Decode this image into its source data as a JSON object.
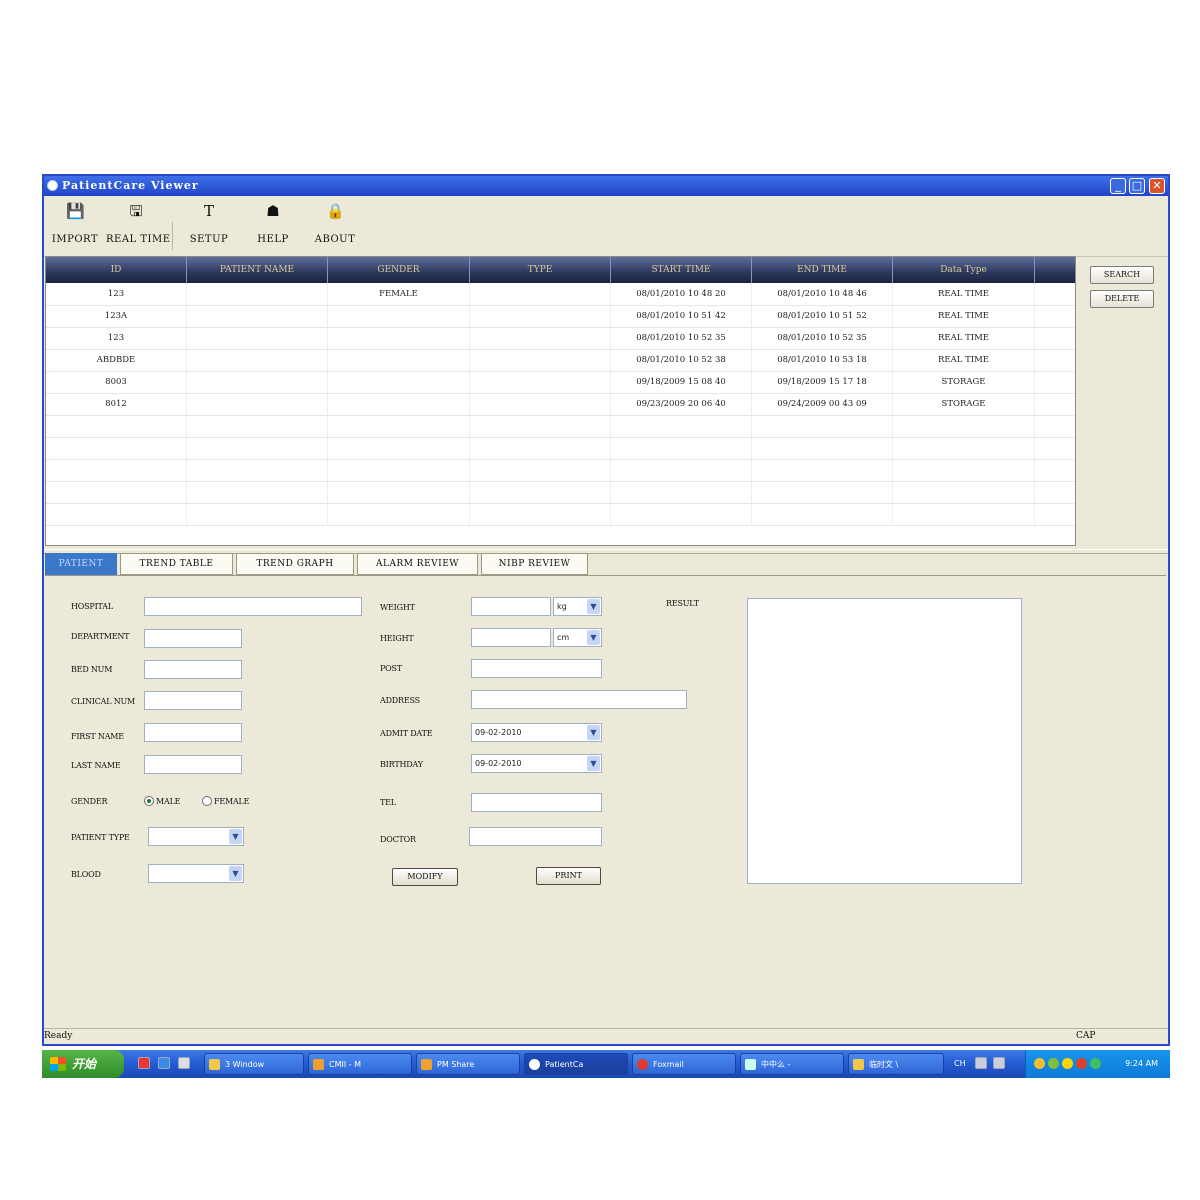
{
  "window": {
    "title": "PatientCare Viewer",
    "min": "_",
    "max": "□",
    "close": "✕"
  },
  "toolbar": [
    {
      "id": "import",
      "label": "IMPORT",
      "icon": "💾"
    },
    {
      "id": "realtime",
      "label": "REAL TIME",
      "icon": "🖫"
    },
    {
      "id": "setup",
      "label": "SETUP",
      "icon": "T"
    },
    {
      "id": "help",
      "label": "HELP",
      "icon": "☗"
    },
    {
      "id": "about",
      "label": "ABOUT",
      "icon": "🔒"
    }
  ],
  "table": {
    "columns": [
      "ID",
      "PATIENT NAME",
      "GENDER",
      "TYPE",
      "START TIME",
      "END   TIME",
      "Data Type"
    ],
    "rows": [
      [
        "123",
        "",
        "FEMALE",
        "",
        "08/01/2010 10 48 20",
        "08/01/2010 10 48 46",
        "REAL TIME"
      ],
      [
        "123A",
        "",
        "",
        "",
        "08/01/2010 10 51 42",
        "08/01/2010 10 51 52",
        "REAL TIME"
      ],
      [
        "123",
        "",
        "",
        "",
        "08/01/2010 10 52 35",
        "08/01/2010 10 52 35",
        "REAL TIME"
      ],
      [
        "ABDBDE",
        "",
        "",
        "",
        "08/01/2010 10 52 38",
        "08/01/2010 10 53 18",
        "REAL TIME"
      ],
      [
        "8003",
        "",
        "",
        "",
        "09/18/2009 15 08 40",
        "09/18/2009 15 17 18",
        "STORAGE"
      ],
      [
        "8012",
        "",
        "",
        "",
        "09/23/2009 20 06 40",
        "09/24/2009 00 43 09",
        "STORAGE"
      ]
    ],
    "empty_rows": 5
  },
  "side_buttons": {
    "search": "SEARCH",
    "delete": "DELETE"
  },
  "tabs": [
    "PATIENT",
    "TREND TABLE",
    "TREND GRAPH",
    "ALARM REVIEW",
    "NIBP REVIEW"
  ],
  "form": {
    "hospital": "HOSPITAL",
    "department": "DEPARTMENT",
    "bed_num": "BED NUM",
    "clinical_num": "CLINICAL NUM",
    "first_name": "FIRST NAME",
    "last_name": "LAST NAME",
    "gender": "GENDER",
    "male": "MALE",
    "female": "FEMALE",
    "patient_type": "PATIENT TYPE",
    "blood": "BLOOD",
    "weight": "WEIGHT",
    "weight_unit": "kg",
    "height": "HEIGHT",
    "height_unit": "cm",
    "post": "POST",
    "address": "ADDRESS",
    "admit_date": "ADMIT DATE",
    "admit_date_value": "09-02-2010",
    "birthday": "BIRTHDAY",
    "birthday_value": "09-02-2010",
    "tel": "TEL",
    "doctor": "DOCTOR",
    "modify": "MODIFY",
    "print": "PRINT",
    "result": "RESULT"
  },
  "status": {
    "left": "Ready",
    "right": "CAP"
  },
  "taskbar": {
    "start": "开始",
    "items": [
      "3 Window",
      "CMII - M",
      "PM Share",
      "PatientCa",
      "Foxmail",
      "中中么 -",
      "临时文 \\"
    ],
    "lang": "CH",
    "clock": "9:24 AM"
  }
}
